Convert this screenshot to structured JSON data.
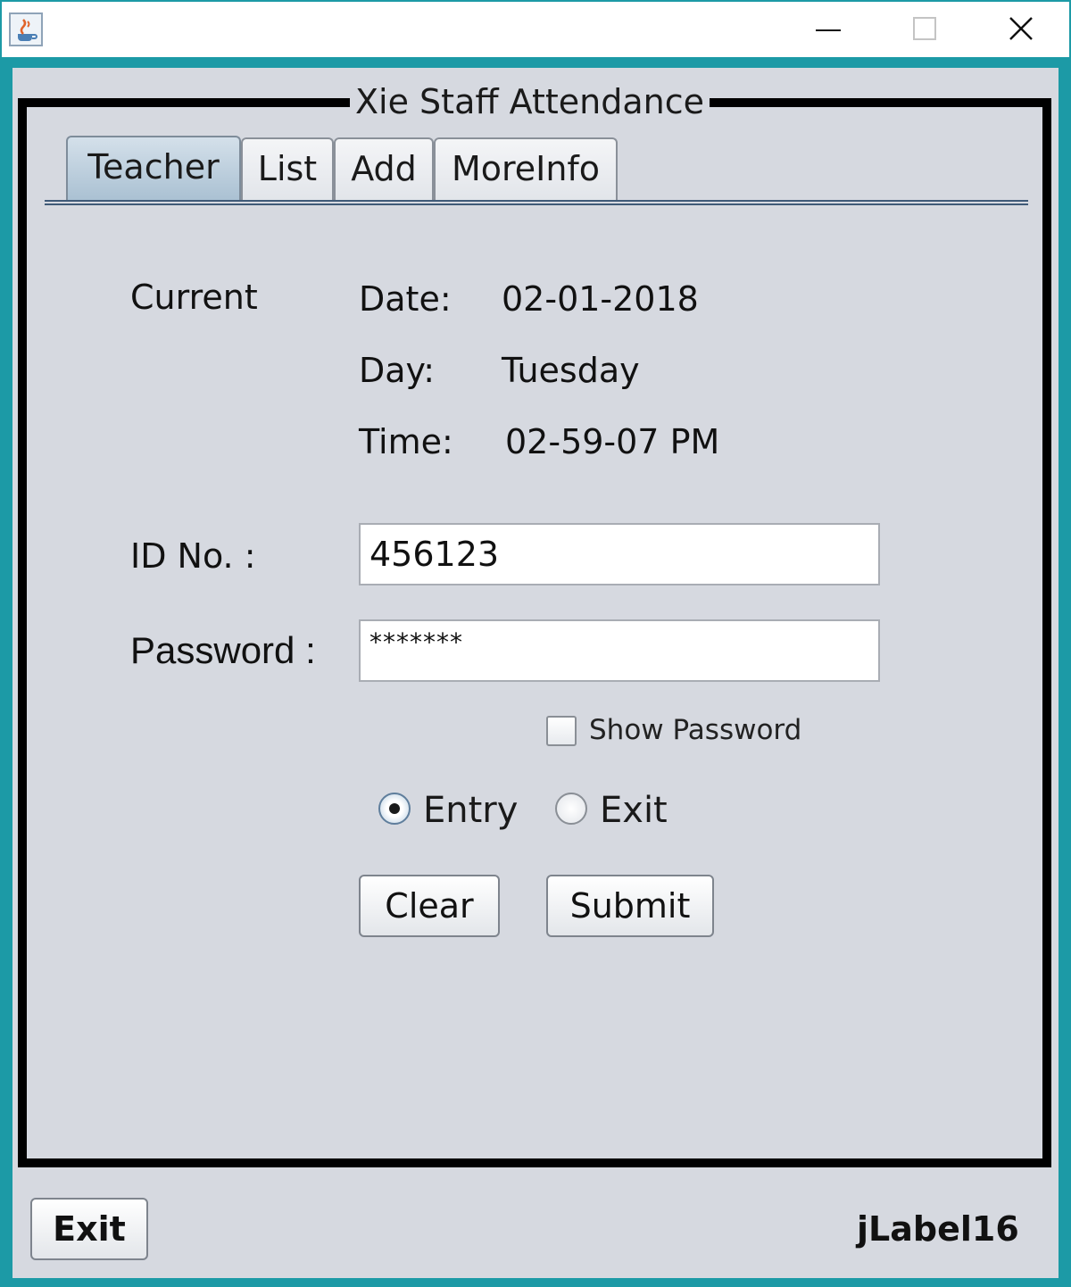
{
  "window": {
    "icon": "java-cup-icon",
    "controls": [
      "minimize-icon",
      "maximize-icon",
      "close-icon"
    ]
  },
  "group_title": "Xie Staff Attendance",
  "tabs": [
    {
      "label": "Teacher",
      "active": true
    },
    {
      "label": "List",
      "active": false
    },
    {
      "label": "Add",
      "active": false
    },
    {
      "label": "MoreInfo",
      "active": false
    }
  ],
  "current": {
    "label": "Current",
    "date_label": "Date:",
    "date_value": "02-01-2018",
    "day_label": "Day:",
    "day_value": "Tuesday",
    "time_label": "Time:",
    "time_value": "02-59-07 PM"
  },
  "form": {
    "id_label": "ID No. :",
    "id_value": "456123",
    "password_label": "Password :",
    "password_value": "*******",
    "show_password_label": "Show Password",
    "show_password_checked": false,
    "radio_entry_label": "Entry",
    "radio_exit_label": "Exit",
    "selected_mode": "Entry",
    "clear_label": "Clear",
    "submit_label": "Submit"
  },
  "footer": {
    "exit_label": "Exit",
    "status_label": "jLabel16"
  },
  "colors": {
    "window_border": "#1c9aa6",
    "panel_bg": "#d6d9e0",
    "active_tab": "#a9c0d2"
  }
}
